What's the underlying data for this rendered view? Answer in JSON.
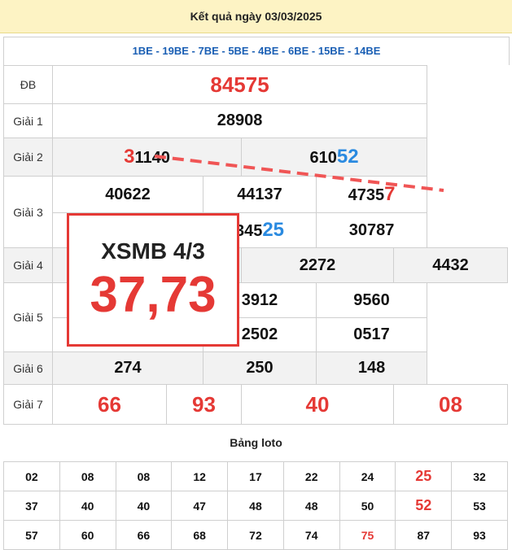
{
  "header": {
    "title": "Kết quả ngày 03/03/2025"
  },
  "codes": "1BE - 19BE - 7BE - 5BE - 4BE - 6BE - 15BE - 14BE",
  "labels": {
    "db": "ĐB",
    "g1": "Giải 1",
    "g2": "Giải 2",
    "g3": "Giải 3",
    "g4": "Giải 4",
    "g5": "Giải 5",
    "g6": "Giải 6",
    "g7": "Giải 7"
  },
  "results": {
    "db": "84575",
    "g1": "28908",
    "g2": {
      "a_pre": "3",
      "a_rest": "1140",
      "b_pre": "610",
      "b_hl": "52"
    },
    "g3": {
      "r1c1": "40622",
      "r1c2": "44137",
      "r1c3_pre": "4735",
      "r1c3_hl": "7",
      "r2c2_pre": "345",
      "r2c2_hl": "25",
      "r2c3": "30787"
    },
    "g4": {
      "c3": "2272",
      "c4": "4432"
    },
    "g5": {
      "r1c2": "3912",
      "r1c3": "9560",
      "r2c2": "2502",
      "r2c3": "0517"
    },
    "g6": [
      "274",
      "250",
      "148"
    ],
    "g7": [
      "66",
      "93",
      "40",
      "08"
    ]
  },
  "overlay": {
    "line1": "XSMB 4/3",
    "line2": "37,73"
  },
  "loto": {
    "title": "Bảng loto",
    "rows": [
      [
        "02",
        "08",
        "08",
        "12",
        "17",
        "22",
        "24",
        "25",
        "32"
      ],
      [
        "37",
        "40",
        "40",
        "47",
        "48",
        "48",
        "50",
        "52",
        "53"
      ],
      [
        "57",
        "60",
        "66",
        "68",
        "72",
        "74",
        "75",
        "87",
        "93"
      ]
    ]
  },
  "colors": {
    "red": "#e53935",
    "blue": "#2a8ae0",
    "header_bg": "#fdf3c4"
  }
}
